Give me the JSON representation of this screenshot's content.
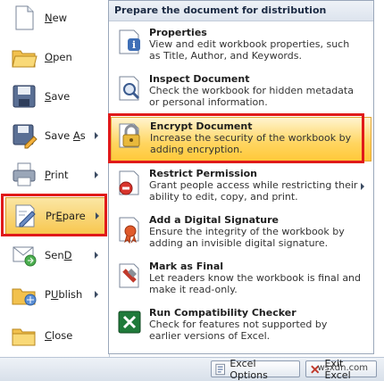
{
  "left_menu": {
    "items": [
      {
        "label": "New",
        "accel": "N",
        "rest": "ew",
        "icon": "new-document-icon"
      },
      {
        "label": "Open",
        "accel": "O",
        "rest": "pen",
        "icon": "open-folder-icon"
      },
      {
        "label": "Save",
        "accel": "S",
        "rest": "ave",
        "icon": "save-disk-icon"
      },
      {
        "label": "Save As",
        "accel": "A",
        "pre": "Save ",
        "rest": "s",
        "icon": "save-as-icon"
      },
      {
        "label": "Print",
        "accel": "P",
        "rest": "rint",
        "icon": "printer-icon"
      },
      {
        "label": "Prepare",
        "accel": "E",
        "pre": "Pr",
        "rest": "pare",
        "icon": "prepare-icon"
      },
      {
        "label": "Send",
        "accel": "D",
        "pre": "Sen",
        "rest": "",
        "icon": "send-icon"
      },
      {
        "label": "Publish",
        "accel": "U",
        "pre": "P",
        "rest": "blish",
        "icon": "publish-icon"
      },
      {
        "label": "Close",
        "accel": "C",
        "rest": "lose",
        "icon": "close-folder-icon"
      }
    ]
  },
  "submenu": {
    "header": "Prepare the document for distribution",
    "items": [
      {
        "title": "Properties",
        "desc": "View and edit workbook properties, such as Title, Author, and Keywords.",
        "icon": "properties-icon"
      },
      {
        "title": "Inspect Document",
        "desc": "Check the workbook for hidden metadata or personal information.",
        "icon": "inspect-document-icon"
      },
      {
        "title": "Encrypt Document",
        "desc": "Increase the security of the workbook by adding encryption.",
        "icon": "encrypt-lock-icon"
      },
      {
        "title": "Restrict Permission",
        "desc": "Grant people access while restricting their ability to edit, copy, and print.",
        "icon": "restrict-permission-icon"
      },
      {
        "title": "Add a Digital Signature",
        "desc": "Ensure the integrity of the workbook by adding an invisible digital signature.",
        "icon": "digital-signature-icon"
      },
      {
        "title": "Mark as Final",
        "desc": "Let readers know the workbook is final and make it read-only.",
        "icon": "mark-final-icon"
      },
      {
        "title": "Run Compatibility Checker",
        "desc": "Check for features not supported by earlier versions of Excel.",
        "icon": "compatibility-checker-icon"
      }
    ]
  },
  "bottom_bar": {
    "options_label": "Excel Options",
    "exit_label": "Exit Excel"
  },
  "watermark": "wsxdn.com",
  "colors": {
    "highlight": "#ffd55f",
    "annotation": "#e01a1a",
    "accent": "#3b5b8f"
  }
}
